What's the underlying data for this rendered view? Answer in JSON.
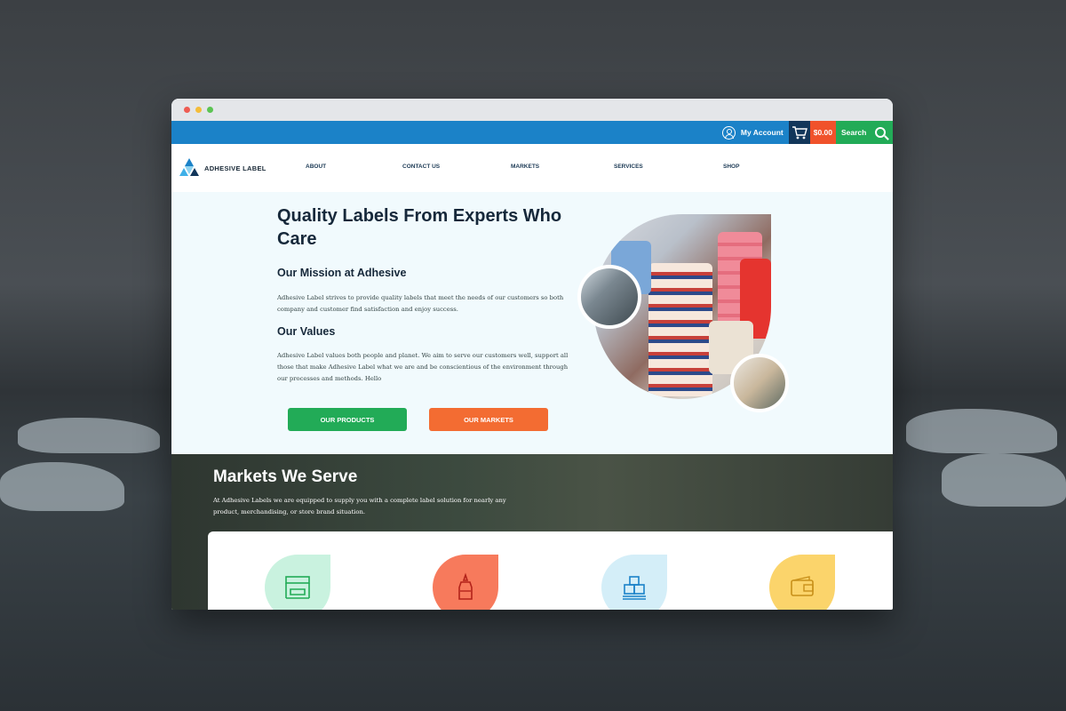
{
  "header": {
    "account_label": "My Account",
    "cart_total": "$0.00",
    "search_label": "Search"
  },
  "brand": {
    "name": "ADHESIVE LABEL"
  },
  "nav": {
    "items": [
      {
        "label": "ABOUT"
      },
      {
        "label": "CONTACT US"
      },
      {
        "label": "MARKETS"
      },
      {
        "label": "SERVICES"
      },
      {
        "label": "SHOP"
      }
    ]
  },
  "hero": {
    "title": "Quality Labels From Experts Who Care",
    "mission_heading": "Our Mission at Adhesive",
    "mission_text": "Adhesive Label strives to provide quality labels that meet the needs of our customers so both company and customer find satisfaction and enjoy success.",
    "values_heading": "Our Values",
    "values_text": "Adhesive Label values both people and planet. We aim to serve our customers well, support all those that make Adhesive Label what we are and be conscientious of the environment through our processes and methods. Hello",
    "btn_products": "OUR PRODUCTS",
    "btn_markets": "OUR MARKETS"
  },
  "markets": {
    "heading": "Markets We Serve",
    "text": "At Adhesive Labels we are equipped to supply you with a complete label solution for nearly any product, merchandising, or store brand situation.",
    "icons": [
      {
        "icon": "storefront-icon",
        "bg": "#c9f2df",
        "stroke": "#22ab57"
      },
      {
        "icon": "bottle-icon",
        "bg": "#f77a5c",
        "stroke": "#b3231a"
      },
      {
        "icon": "pallet-boxes-icon",
        "bg": "#d4eef8",
        "stroke": "#1b82c8"
      },
      {
        "icon": "wallet-icon",
        "bg": "#fbd46b",
        "stroke": "#c8901a"
      }
    ]
  },
  "colors": {
    "blue": "#1b82c8",
    "navy": "#12365a",
    "orange": "#f36c32",
    "green": "#22ab57"
  }
}
